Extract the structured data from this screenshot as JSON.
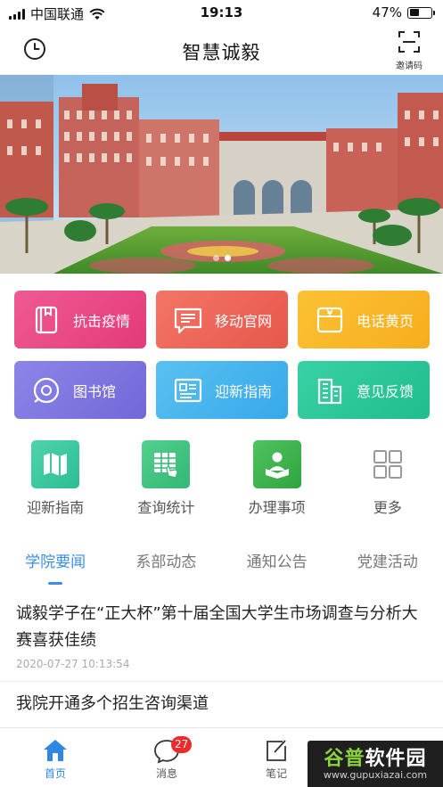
{
  "status_bar": {
    "carrier": "中国联通",
    "time": "19:13",
    "battery": "47%"
  },
  "nav": {
    "title": "智慧诚毅",
    "invite_label": "邀请码"
  },
  "banner": {
    "page_count": 2,
    "active_page": 1
  },
  "tiles": [
    {
      "label": "抗击疫情",
      "icon": "book-icon",
      "color": "#e84a86"
    },
    {
      "label": "移动官网",
      "icon": "chat-message-icon",
      "color": "#ee6659"
    },
    {
      "label": "电话黄页",
      "icon": "yellow-pages-icon",
      "color": "#f9b828"
    },
    {
      "label": "图书馆",
      "icon": "library-icon",
      "color": "#7f76df"
    },
    {
      "label": "迎新指南",
      "icon": "guide-document-icon",
      "color": "#47b4ee"
    },
    {
      "label": "意见反馈",
      "icon": "buildings-icon",
      "color": "#2cc799"
    }
  ],
  "quick": [
    {
      "label": "迎新指南",
      "icon": "map-icon"
    },
    {
      "label": "查询统计",
      "icon": "spreadsheet-touch-icon"
    },
    {
      "label": "办理事项",
      "icon": "person-reading-icon"
    },
    {
      "label": "更多",
      "icon": "grid-more-icon"
    }
  ],
  "tabs": [
    {
      "label": "学院要闻",
      "active": true
    },
    {
      "label": "系部动态",
      "active": false
    },
    {
      "label": "通知公告",
      "active": false
    },
    {
      "label": "党建活动",
      "active": false
    }
  ],
  "news": [
    {
      "title": "诚毅学子在“正大杯”第十届全国大学生市场调查与分析大赛喜获佳绩",
      "date": "2020-07-27 10:13:54"
    },
    {
      "title": "我院开通多个招生咨询渠道",
      "date": ""
    }
  ],
  "tabbar": {
    "home": "首页",
    "messages": "消息",
    "messages_badge": "27",
    "notes": "笔记"
  },
  "watermark": {
    "line1_a": "谷普",
    "line1_b": "软件园",
    "line2": "www.gupuxiazai.com"
  },
  "colors": {
    "accent": "#3a8ee6",
    "badge": "#ee2b2b"
  }
}
